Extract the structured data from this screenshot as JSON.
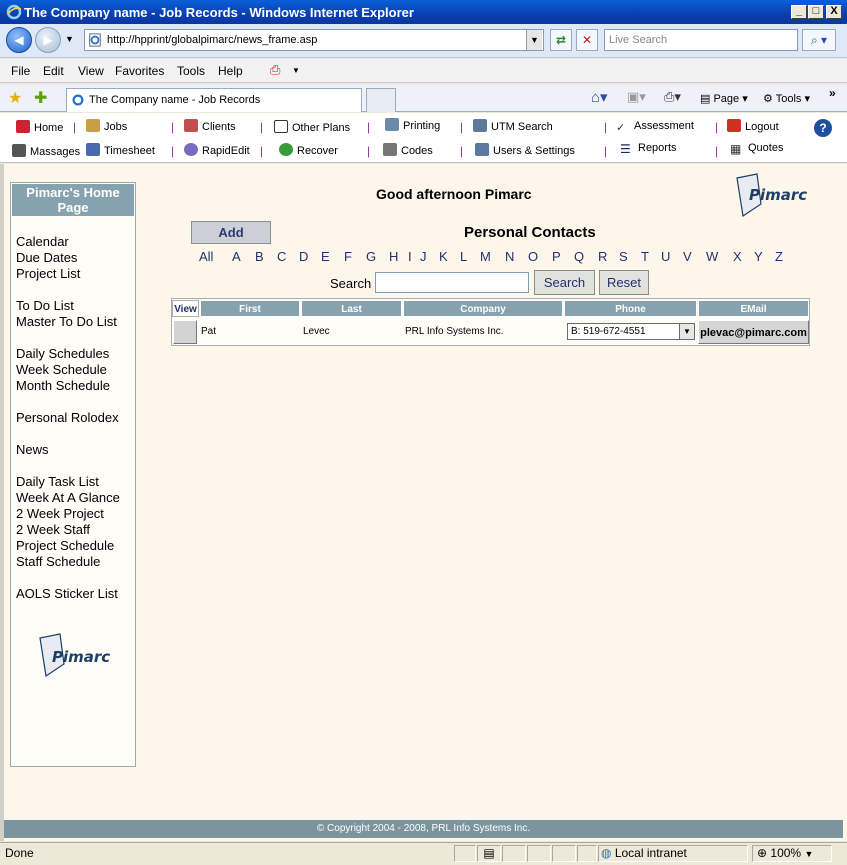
{
  "window": {
    "title": "The Company name - Job Records - Windows Internet Explorer",
    "min": "_",
    "max": "□",
    "close": "X"
  },
  "browser": {
    "back": "◀",
    "forward": "▶",
    "url": "http://hpprint/globalpimarc/news_frame.asp",
    "search_placeholder": "Live Search",
    "menu": [
      "File",
      "Edit",
      "View",
      "Favorites",
      "Tools",
      "Help"
    ],
    "tab_title": "The Company name - Job Records",
    "cmd_page": "Page",
    "cmd_tools": "Tools"
  },
  "toolbar": {
    "row1": [
      "Home",
      "Jobs",
      "Clients",
      "Other Plans",
      "Printing",
      "UTM Search",
      "Assessment",
      "Logout"
    ],
    "row2": [
      "Massages",
      "Timesheet",
      "RapidEdit",
      "Recover",
      "Codes",
      "Users & Settings",
      "Reports",
      "Quotes"
    ]
  },
  "sidebar": {
    "heading": "Pimarc's Home Page",
    "links": [
      "Calendar",
      "Due Dates",
      "Project List",
      "To Do List",
      "Master To Do List",
      "Daily Schedules",
      "Week Schedule",
      "Month Schedule",
      "Personal Rolodex",
      "News",
      "Daily Task List",
      "Week At A Glance",
      "2 Week Project",
      "2 Week Staff",
      "Project Schedule",
      "Staff Schedule",
      "AOLS Sticker List"
    ],
    "logo": "Pimarc"
  },
  "main": {
    "greeting": "Good afternoon Pimarc",
    "logo": "Pimarc",
    "add_label": "Add",
    "heading": "Personal Contacts",
    "letters": [
      "All",
      "A",
      "B",
      "C",
      "D",
      "E",
      "F",
      "G",
      "H",
      "I",
      "J",
      "K",
      "L",
      "M",
      "N",
      "O",
      "P",
      "Q",
      "R",
      "S",
      "T",
      "U",
      "V",
      "W",
      "X",
      "Y",
      "Z"
    ],
    "search_label": "Search",
    "search_value": "",
    "search_button": "Search",
    "reset_button": "Reset",
    "table": {
      "headers": [
        "View",
        "First",
        "Last",
        "Company",
        "Phone",
        "EMail"
      ],
      "rows": [
        {
          "first": "Pat",
          "last": "Levec",
          "company": "PRL Info Systems Inc.",
          "phone": "B: 519-672-4551",
          "email": "plevac@pimarc.com"
        }
      ]
    }
  },
  "footer": "© Copyright 2004 - 2008, PRL Info Systems Inc.",
  "status": {
    "text": "Done",
    "zone": "Local intranet",
    "zoom": "100%"
  }
}
